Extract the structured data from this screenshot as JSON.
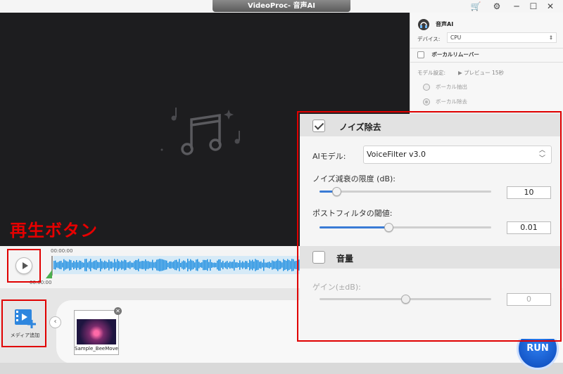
{
  "window": {
    "title": "VideoProc- 音声AI"
  },
  "right_panel": {
    "header": "音声AI",
    "device_label": "デバイス:",
    "device_value": "CPU",
    "vocal_remover": "ボーカルリムーバー",
    "model_setting_label": "モデル設定:",
    "preview_label": "プレビュー 15秒",
    "option_extract": "ボーカル抽出",
    "option_remove": "ボーカル除去"
  },
  "timeline": {
    "time_top": "00:00:00",
    "time_bottom": "00:00:00"
  },
  "annotation": {
    "play_button_label": "再生ボタン"
  },
  "media": {
    "add_media_label": "メディア追加",
    "file_name": "Sample_BeeMove",
    "run_label": "RUN"
  },
  "noise_panel": {
    "title": "ノイズ除去",
    "checked": true,
    "model_label": "AIモデル:",
    "model_value": "VoiceFilter v3.0",
    "limit_label": "ノイズ減衰の限度 (dB):",
    "limit_value": "10",
    "limit_fraction": 0.1,
    "threshold_label": "ポストフィルタの閾値:",
    "threshold_value": "0.01",
    "threshold_fraction": 0.4,
    "volume_title": "音量",
    "volume_checked": false,
    "gain_label": "ゲイン(±dB):",
    "gain_value": "0",
    "gain_fraction": 0.5
  },
  "colors": {
    "accent": "#3a7bd5",
    "annotation_red": "#e00000",
    "waveform": "#1e8ee0"
  }
}
